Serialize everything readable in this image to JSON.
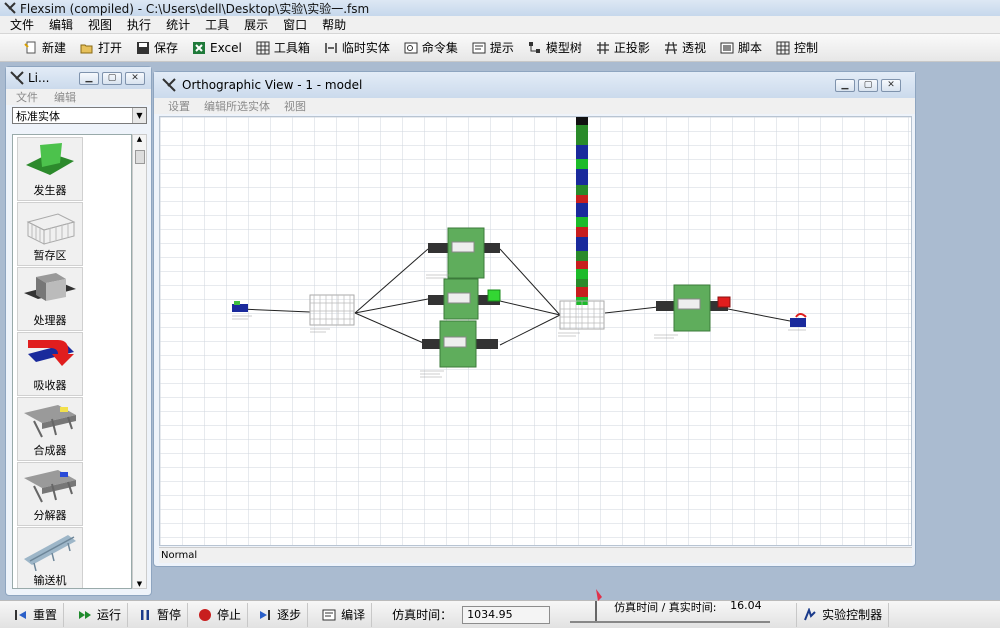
{
  "app": {
    "title": "Flexsim (compiled) - C:\\Users\\dell\\Desktop\\实验\\实验一.fsm"
  },
  "menu": [
    "文件",
    "编辑",
    "视图",
    "执行",
    "统计",
    "工具",
    "展示",
    "窗口",
    "帮助"
  ],
  "toolbar": {
    "new": "新建",
    "open": "打开",
    "save": "保存",
    "excel": "Excel",
    "toolbox": "工具箱",
    "temp_entity": "临时实体",
    "command_set": "命令集",
    "hint": "提示",
    "model_tree": "模型树",
    "ortho": "正投影",
    "perspective": "透视",
    "script": "脚本",
    "control": "控制"
  },
  "library": {
    "title": "Li...",
    "menu": [
      "文件",
      "编辑"
    ],
    "category": "标准实体",
    "items": [
      "发生器",
      "暂存区",
      "处理器",
      "吸收器",
      "合成器",
      "分解器",
      "输送机"
    ]
  },
  "ortho_view": {
    "title": "Orthographic View - 1 - model",
    "menu": [
      "设置",
      "编辑所选实体",
      "视图"
    ],
    "status": "Normal"
  },
  "controls": {
    "reset": "重置",
    "run": "运行",
    "pause": "暂停",
    "stop": "停止",
    "step": "逐步",
    "compile": "编译",
    "sim_time_label": "仿真时间：",
    "sim_time_value": "1034.95",
    "ratio_label": "仿真时间 / 真实时间:",
    "ratio_value": "16.04",
    "experimenter": "实验控制器"
  },
  "colors": {
    "queue_fill": "#5fad5c",
    "source_fill": "#1a2a9c",
    "accent_red": "#e01e1e"
  }
}
